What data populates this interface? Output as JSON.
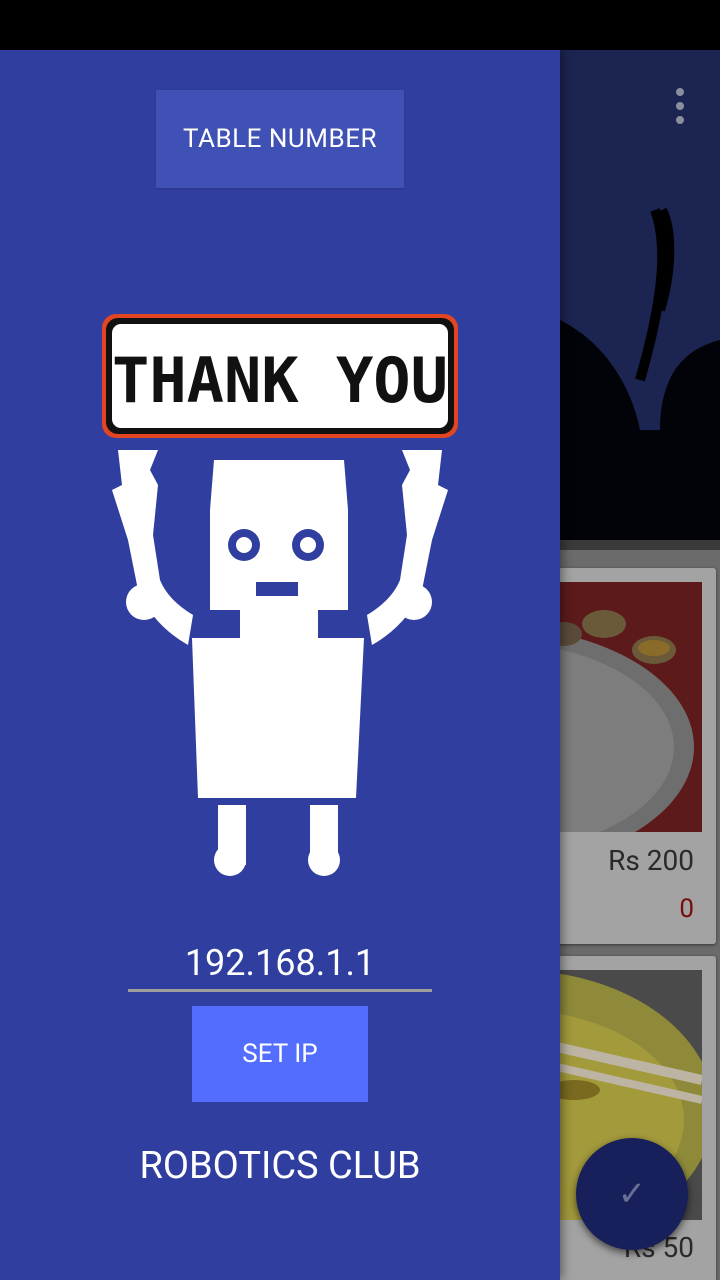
{
  "drawer": {
    "table_button_label": "TABLE NUMBER",
    "thank_you_sign": "THANK YOU",
    "ip_value": "192.168.1.1",
    "set_ip_label": "SET IP",
    "club_label": "ROBOTICS CLUB"
  },
  "menu_items": [
    {
      "price": "Rs 200",
      "quantity": "0"
    },
    {
      "price": "Rs 50"
    }
  ],
  "fab": {
    "icon": "check-icon",
    "glyph": "✓"
  },
  "colors": {
    "drawer_bg": "#303f9f",
    "table_button": "#3f51b5",
    "set_ip_button": "#536dfe",
    "quantity_text": "#7a0b0b"
  }
}
